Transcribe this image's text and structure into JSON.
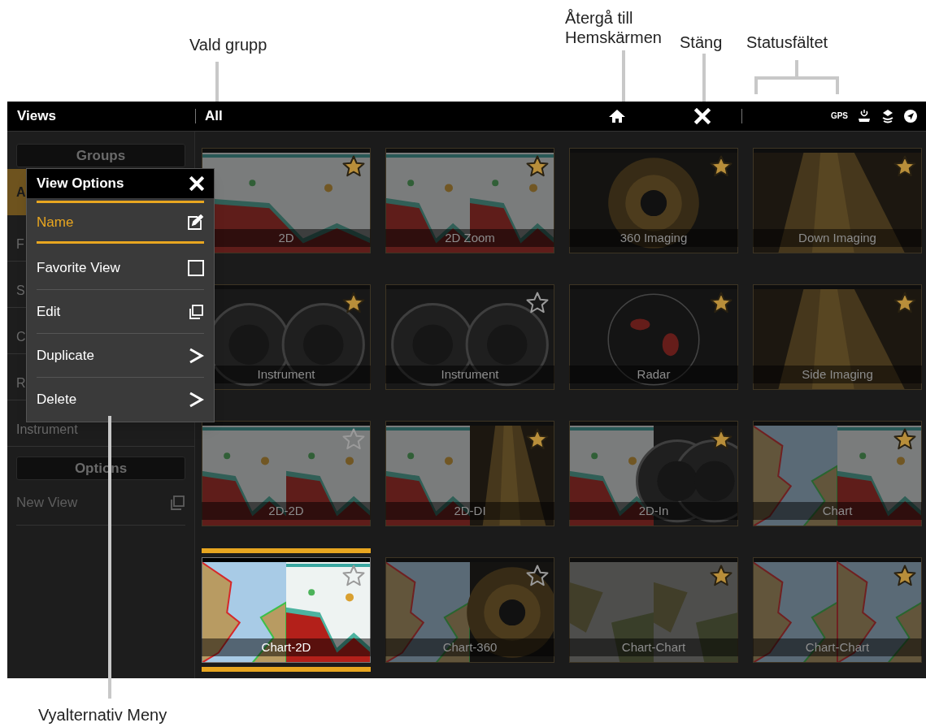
{
  "callouts": [
    {
      "text": "Vald grupp"
    },
    {
      "text": "Återgå till Hemskärmen"
    },
    {
      "text": "Stäng"
    },
    {
      "text": "Statusfältet"
    },
    {
      "text": "Vyalternativ Meny"
    }
  ],
  "top_bar": {
    "title": "Views",
    "group": "All",
    "status": [
      {
        "kind": "gps",
        "label": "GPS"
      },
      {
        "kind": "power"
      },
      {
        "kind": "sonar"
      },
      {
        "kind": "nav"
      }
    ]
  },
  "sidebar": {
    "groups_header": "Groups",
    "groups": [
      {
        "label": "A",
        "selected": true
      },
      {
        "label": "F",
        "selected": false
      },
      {
        "label": "S",
        "selected": false
      },
      {
        "label": "C",
        "selected": false
      },
      {
        "label": "R",
        "selected": false
      },
      {
        "label": "Instrument",
        "selected": false
      }
    ],
    "options_header": "Options",
    "options": [
      {
        "label": "New View"
      }
    ]
  },
  "view_options": {
    "title": "View Options",
    "items": [
      {
        "label": "Name",
        "kind": "edit",
        "selected": true
      },
      {
        "label": "Favorite View",
        "kind": "checkbox",
        "checked": false,
        "selected": false
      },
      {
        "label": "Edit",
        "kind": "copy",
        "selected": false
      },
      {
        "label": "Duplicate",
        "kind": "submenu",
        "selected": false
      },
      {
        "label": "Delete",
        "kind": "submenu",
        "selected": false
      }
    ]
  },
  "views": [
    {
      "name": "2D",
      "favorite": true,
      "selected": false
    },
    {
      "name": "2D Zoom",
      "favorite": true,
      "selected": false
    },
    {
      "name": "360 Imaging",
      "favorite": true,
      "selected": false
    },
    {
      "name": "Down Imaging",
      "favorite": true,
      "selected": false
    },
    {
      "name": "Instrument",
      "favorite": true,
      "selected": false
    },
    {
      "name": "Instrument",
      "favorite": false,
      "selected": false
    },
    {
      "name": "Radar",
      "favorite": true,
      "selected": false
    },
    {
      "name": "Side Imaging",
      "favorite": true,
      "selected": false
    },
    {
      "name": "2D-2D",
      "favorite": false,
      "selected": false
    },
    {
      "name": "2D-DI",
      "favorite": true,
      "selected": false
    },
    {
      "name": "2D-In",
      "favorite": true,
      "selected": false
    },
    {
      "name": "Chart",
      "favorite": true,
      "selected": false
    },
    {
      "name": "Chart-2D",
      "favorite": false,
      "selected": true
    },
    {
      "name": "Chart-360",
      "favorite": false,
      "selected": false
    },
    {
      "name": "Chart-Chart",
      "favorite": true,
      "selected": false
    },
    {
      "name": "Chart-Chart",
      "favorite": true,
      "selected": false
    }
  ]
}
